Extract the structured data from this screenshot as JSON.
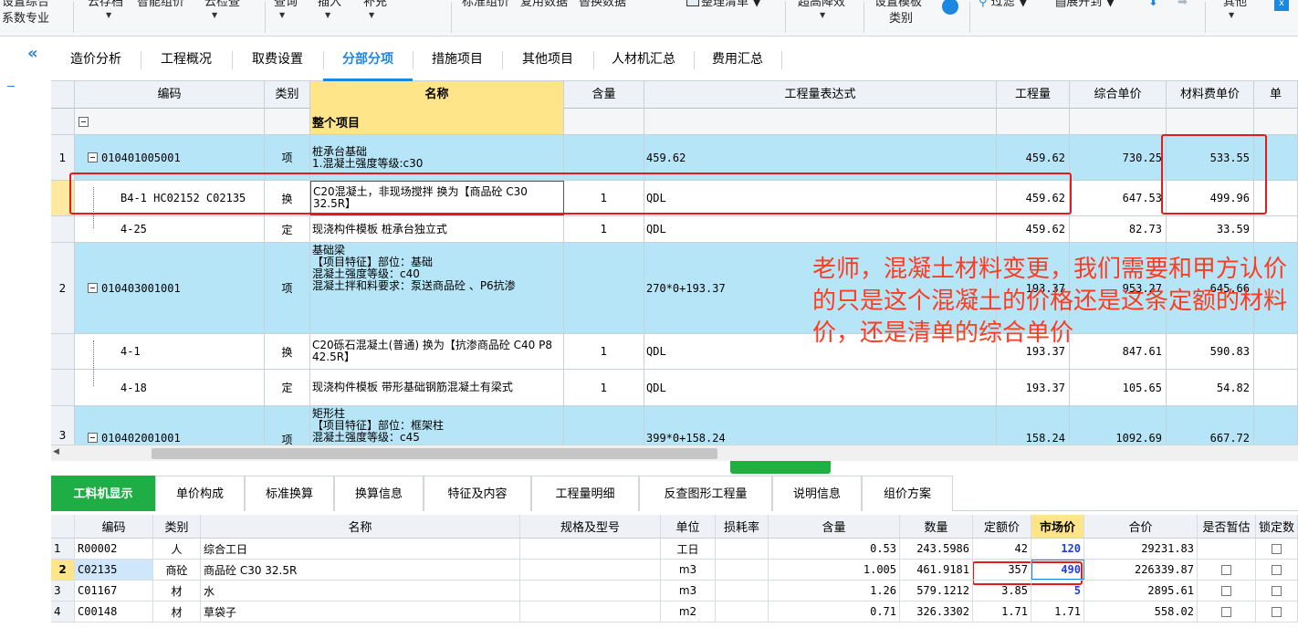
{
  "ribbon": {
    "left_top": "设置综合",
    "left_bottom": "系数专业",
    "items": [
      "云存档",
      "智能组价",
      "云检查",
      "查询",
      "插入",
      "补充",
      "标准组价",
      "复用数据",
      "替换数据",
      "整理清单",
      "超高降效",
      "设置模板",
      "类别",
      "过滤",
      "展开到",
      "其他"
    ],
    "colors": {
      "accent": "#1a88e0",
      "green": "#1fae45",
      "row_blue": "#b6e5f7",
      "highlight": "#ffe58a",
      "annotation": "#ff3b1f"
    }
  },
  "tabs": [
    "造价分析",
    "工程概况",
    "取费设置",
    "分部分项",
    "措施项目",
    "其他项目",
    "人材机汇总",
    "费用汇总"
  ],
  "active_tab": "分部分项",
  "grid": {
    "headers": [
      "编码",
      "类别",
      "名称",
      "含量",
      "工程量表达式",
      "工程量",
      "综合单价",
      "材料费单价",
      "单"
    ],
    "rows": [
      {
        "no": "",
        "code": "",
        "type": "",
        "name": "整个项目",
        "qty_ratio": "",
        "expr": "",
        "qty": "",
        "unit_price": "",
        "mat_price": ""
      },
      {
        "no": "1",
        "code": "010401005001",
        "type": "项",
        "name": "桩承台基础\n1.混凝土强度等级:c30",
        "qty_ratio": "",
        "expr": "459.62",
        "qty": "459.62",
        "unit_price": "730.25",
        "mat_price": "533.55"
      },
      {
        "no": "",
        "code": "B4-1 HC02152 C02135",
        "type": "换",
        "name": "C20混凝土，非现场搅拌  换为【商品砼 C30 32.5R】",
        "qty_ratio": "1",
        "expr": "QDL",
        "qty": "459.62",
        "unit_price": "647.53",
        "mat_price": "499.96"
      },
      {
        "no": "",
        "code": "4-25",
        "type": "定",
        "name": "现浇构件模板 桩承台独立式",
        "qty_ratio": "1",
        "expr": "QDL",
        "qty": "459.62",
        "unit_price": "82.73",
        "mat_price": "33.59"
      },
      {
        "no": "2",
        "code": "010403001001",
        "type": "项",
        "name": "基础梁\n【项目特征】部位：基础\n混凝土强度等级：c40\n混凝土拌和料要求：泵送商品砼 、P6抗渗",
        "qty_ratio": "",
        "expr": "270*0+193.37",
        "qty": "193.37",
        "unit_price": "953.27",
        "mat_price": "645.66"
      },
      {
        "no": "",
        "code": "4-1",
        "type": "换",
        "name": "C20砾石混凝土(普通)   换为【抗渗商品砼 C40 P8 42.5R】",
        "qty_ratio": "1",
        "expr": "QDL",
        "qty": "193.37",
        "unit_price": "847.61",
        "mat_price": "590.83"
      },
      {
        "no": "",
        "code": "4-18",
        "type": "定",
        "name": "现浇构件模板 带形基础钢筋混凝土有梁式",
        "qty_ratio": "1",
        "expr": "QDL",
        "qty": "193.37",
        "unit_price": "105.65",
        "mat_price": "54.82"
      },
      {
        "no": "3",
        "code": "010402001001",
        "type": "项",
        "name": "矩形柱\n【项目特征】部位：框架柱\n混凝土强度等级：c45",
        "qty_ratio": "",
        "expr": "399*0+158.24",
        "qty": "158.24",
        "unit_price": "1092.69",
        "mat_price": "667.72"
      }
    ]
  },
  "annotation": "老师，混凝土材料变更，我们需要和甲方认价的只是这个混凝土的价格还是这条定额的材料价，还是清单的综合单价",
  "bottom_tabs": [
    "工料机显示",
    "单价构成",
    "标准换算",
    "换算信息",
    "特征及内容",
    "工程量明细",
    "反查图形工程量",
    "说明信息",
    "组价方案"
  ],
  "lower": {
    "headers": [
      "编码",
      "类别",
      "名称",
      "规格及型号",
      "单位",
      "损耗率",
      "含量",
      "数量",
      "定额价",
      "市场价",
      "合价",
      "是否暂估",
      "锁定数"
    ],
    "rows": [
      {
        "no": "1",
        "code": "R00002",
        "type": "人",
        "name": "综合工日",
        "spec": "",
        "unit": "工日",
        "loss": "",
        "ratio": "0.53",
        "count": "243.5986",
        "quota": "42",
        "market": "120",
        "total": "29231.83"
      },
      {
        "no": "2",
        "code": "C02135",
        "type": "商砼",
        "name": "商品砼 C30 32.5R",
        "spec": "",
        "unit": "m3",
        "loss": "",
        "ratio": "1.005",
        "count": "461.9181",
        "quota": "357",
        "market": "490",
        "total": "226339.87"
      },
      {
        "no": "3",
        "code": "C01167",
        "type": "材",
        "name": "水",
        "spec": "",
        "unit": "m3",
        "loss": "",
        "ratio": "1.26",
        "count": "579.1212",
        "quota": "3.85",
        "market": "5",
        "total": "2895.61"
      },
      {
        "no": "4",
        "code": "C00148",
        "type": "材",
        "name": "草袋子",
        "spec": "",
        "unit": "m2",
        "loss": "",
        "ratio": "0.71",
        "count": "326.3302",
        "quota": "1.71",
        "market": "1.71",
        "total": "558.02"
      }
    ]
  }
}
